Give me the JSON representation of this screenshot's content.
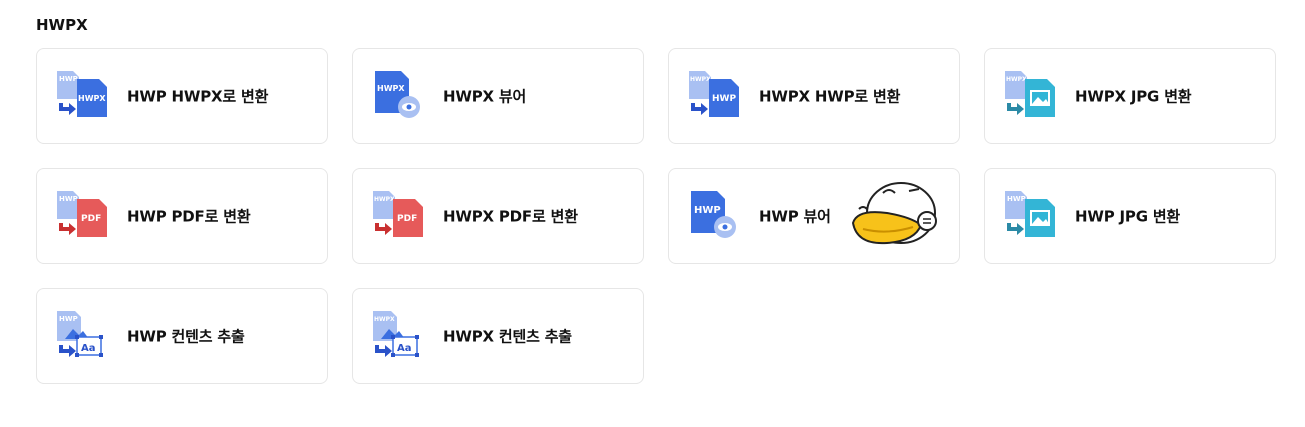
{
  "section": {
    "title": "HWPX"
  },
  "tools": [
    {
      "label": "HWP HWPX로 변환",
      "icon": "hwp-to-hwpx-icon"
    },
    {
      "label": "HWPX 뷰어",
      "icon": "hwpx-viewer-icon"
    },
    {
      "label": "HWPX HWP로 변환",
      "icon": "hwpx-to-hwp-icon"
    },
    {
      "label": "HWPX JPG 변환",
      "icon": "hwpx-to-jpg-icon"
    },
    {
      "label": "HWP PDF로 변환",
      "icon": "hwp-to-pdf-icon"
    },
    {
      "label": "HWPX PDF로 변환",
      "icon": "hwpx-to-pdf-icon"
    },
    {
      "label": "HWP 뷰어",
      "icon": "hwp-viewer-icon"
    },
    {
      "label": "HWP JPG 변환",
      "icon": "hwp-to-jpg-icon"
    },
    {
      "label": "HWP 컨텐츠 추출",
      "icon": "hwp-content-extract-icon"
    },
    {
      "label": "HWPX 컨텐츠 추출",
      "icon": "hwpx-content-extract-icon"
    }
  ],
  "icon_text": {
    "hwp": "HWP",
    "hwpx": "HWPX",
    "pdf": "PDF",
    "aa": "Aa"
  },
  "colors": {
    "blue": "#3b6fe0",
    "light_blue": "#a9c0f2",
    "red": "#e65a5a",
    "teal": "#33b5d6",
    "arrow_blue": "#2a52c9",
    "arrow_red": "#c93030",
    "arrow_teal": "#2b8aa6",
    "mascot_yellow": "#f7c21a"
  }
}
